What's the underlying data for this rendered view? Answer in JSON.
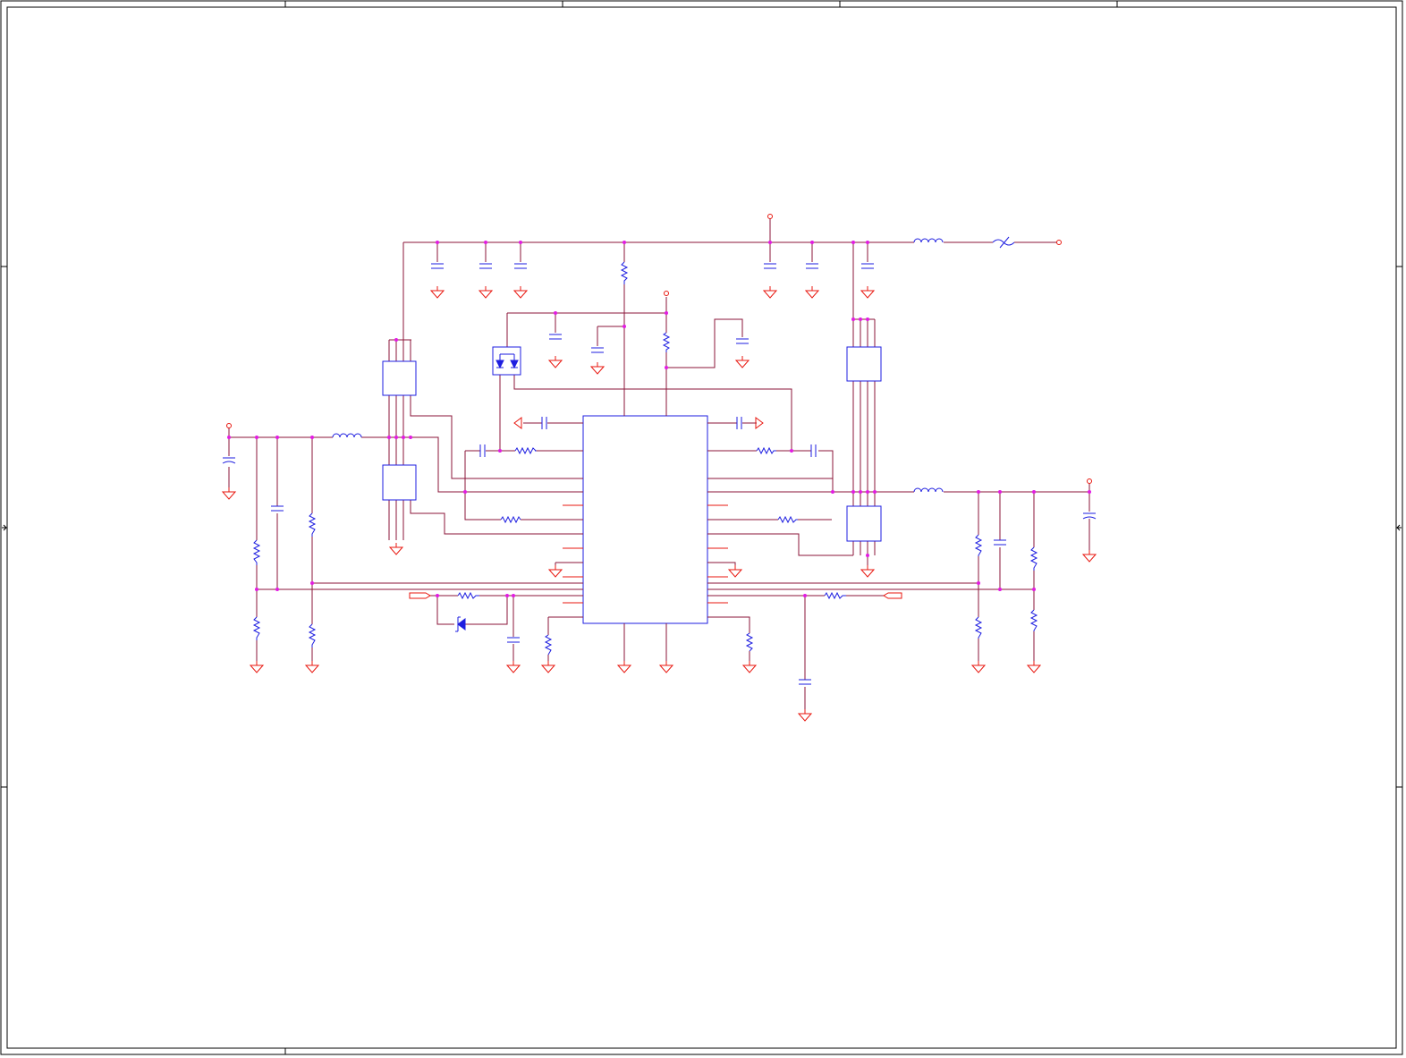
{
  "document": {
    "type": "electrical schematic sheet",
    "colors": {
      "border": "#000000",
      "wire": "#8b1538",
      "pin": "#e8170f",
      "component": "#1e1ee0",
      "junction": "#e21ce2"
    },
    "icons": [
      "ground-symbol",
      "power-port-symbol",
      "resistor-symbol",
      "capacitor-symbol",
      "inductor-symbol",
      "fuse-symbol",
      "schottky-diode-symbol",
      "zener-diode-symbol",
      "ic-body",
      "connector-port"
    ]
  }
}
